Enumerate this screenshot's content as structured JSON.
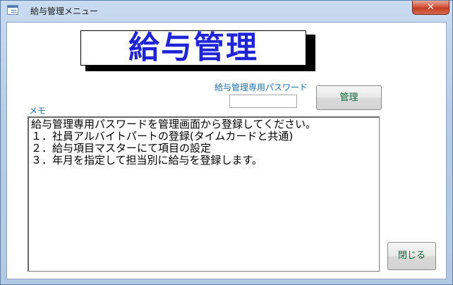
{
  "window": {
    "title": "給与管理メニュー",
    "close_label": "✕"
  },
  "banner": {
    "title": "給与管理"
  },
  "password": {
    "label": "給与管理専用パスワード",
    "value": ""
  },
  "buttons": {
    "manage_label": "管理",
    "close_label": "閉じる"
  },
  "memo": {
    "label": "メモ",
    "lines": [
      "給与管理専用パスワードを管理画面から登録してください。",
      "１．社員アルバイトパートの登録(タイムカードと共通)",
      "２．給与項目マスターにて項目の設定",
      "３．年月を指定して担当別に給与を登録します。"
    ]
  },
  "colors": {
    "banner_text": "#1f24d9",
    "label_text": "#1f6fa9",
    "button_text": "#0a6a3a"
  }
}
